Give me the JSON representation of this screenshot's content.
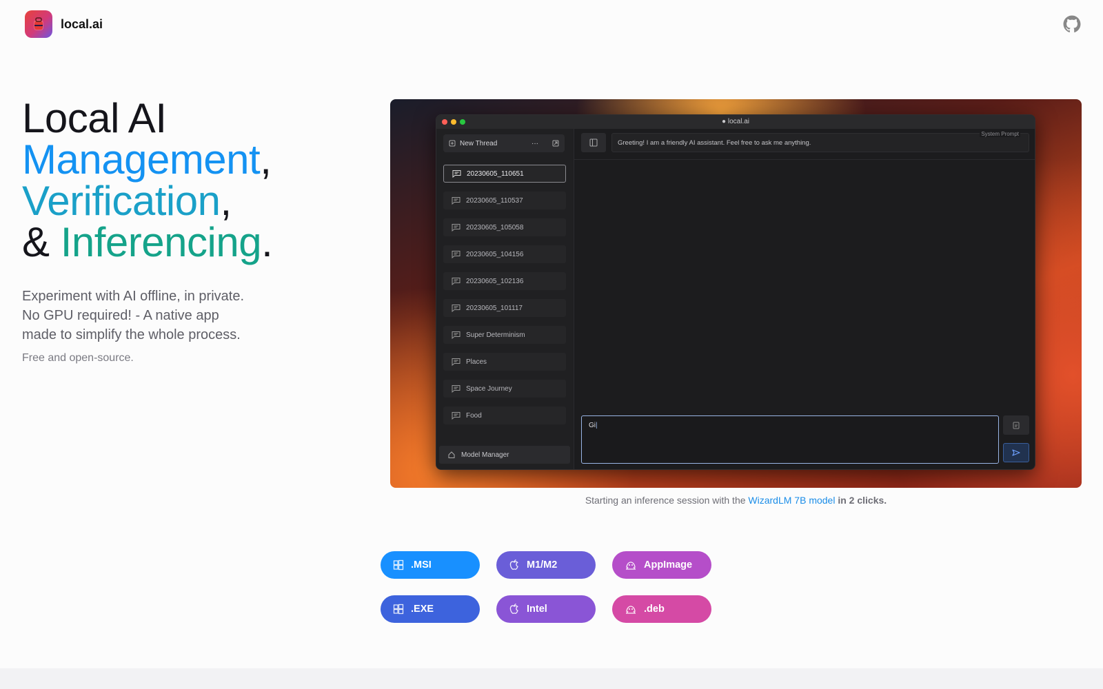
{
  "header": {
    "brand": "local.ai"
  },
  "hero": {
    "line1": "Local AI",
    "line2_word": "Management",
    "line2_punct": ",",
    "line3_word": "Verification",
    "line3_punct": ",",
    "line4_amp": "& ",
    "line4_word": "Inferencing",
    "line4_punct": ".",
    "sub_lines": [
      "Experiment with AI offline, in private.",
      "No GPU required! - A native app",
      "made to simplify the whole process."
    ],
    "free_note": "Free and open-source."
  },
  "app": {
    "window_title": "local.ai",
    "new_thread": "New Thread",
    "new_thread_more": "···",
    "threads": [
      "20230605_110651",
      "20230605_110537",
      "20230605_105058",
      "20230605_104156",
      "20230605_102136",
      "20230605_101117",
      "Super Determinism",
      "Places",
      "Space Journey",
      "Food"
    ],
    "selected_thread_index": 0,
    "model_manager": "Model Manager",
    "system_prompt_label": "System Prompt",
    "system_prompt_text": "Greeting! I am a friendly AI assistant. Feel free to ask me anything.",
    "input_value": "Gi"
  },
  "caption": {
    "prefix": "Starting an inference session with the ",
    "link": "WizardLM 7B model",
    "suffix": " in 2 clicks."
  },
  "downloads": [
    {
      "label": ".MSI",
      "icon": "windows-icon",
      "color": "#1890ff"
    },
    {
      "label": "M1/M2",
      "icon": "apple-icon",
      "color": "#6a5ed8"
    },
    {
      "label": "AppImage",
      "icon": "linux-icon",
      "color": "#b54ec9"
    },
    {
      "label": ".EXE",
      "icon": "windows-icon",
      "color": "#3d63dd"
    },
    {
      "label": "Intel",
      "icon": "apple-icon",
      "color": "#8a55d6"
    },
    {
      "label": ".deb",
      "icon": "linux-icon",
      "color": "#d54aa5"
    }
  ]
}
